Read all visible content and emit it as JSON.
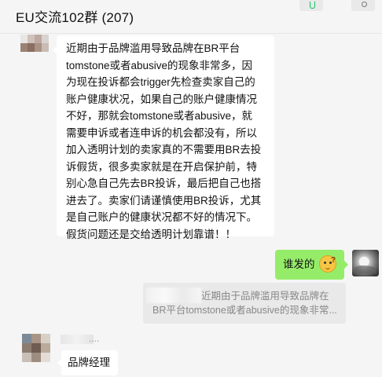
{
  "chat": {
    "title": "EU交流102群 (207)"
  },
  "header_icons": [
    "pin-icon",
    "more-icon"
  ],
  "messages": {
    "long_text": "近期由于品牌滥用导致品牌在BR平台\ntomstone或者abusive的现象非常多，因\n为现在投诉都会trigger先检查卖家自己的\n账户健康状况，如果自己的账户健康情况\n不好，那就会tomstone或者abusive，就\n需要申诉或者连申诉的机会都没有，所以\n加入透明计划的卖家真的不需要用BR去投\n诉假货，很多卖家就是在开启保护前，特\n别心急自己先去BR投诉，最后把自己也搭\n进去了。卖家们请谨慎使用BR投诉，尤其\n是自己账户的健康状况都不好的情况下。\n假货问题还是交给透明计划靠谱！！",
    "reply_text": "谁发的",
    "reply_emoji": "thinking-face-icon",
    "quote_line1": "近期由于品牌滥用导致品牌在",
    "quote_line2": "BR平台tomstone或者abusive的现象非常...",
    "nickname_suffix": "....",
    "short_text": "品牌经理"
  },
  "colors": {
    "background": "#f5f5f5",
    "incoming_bubble": "#ffffff",
    "outgoing_bubble": "#95ec69",
    "quote_bg": "#e9e9e9",
    "accent_green": "#07c160"
  }
}
